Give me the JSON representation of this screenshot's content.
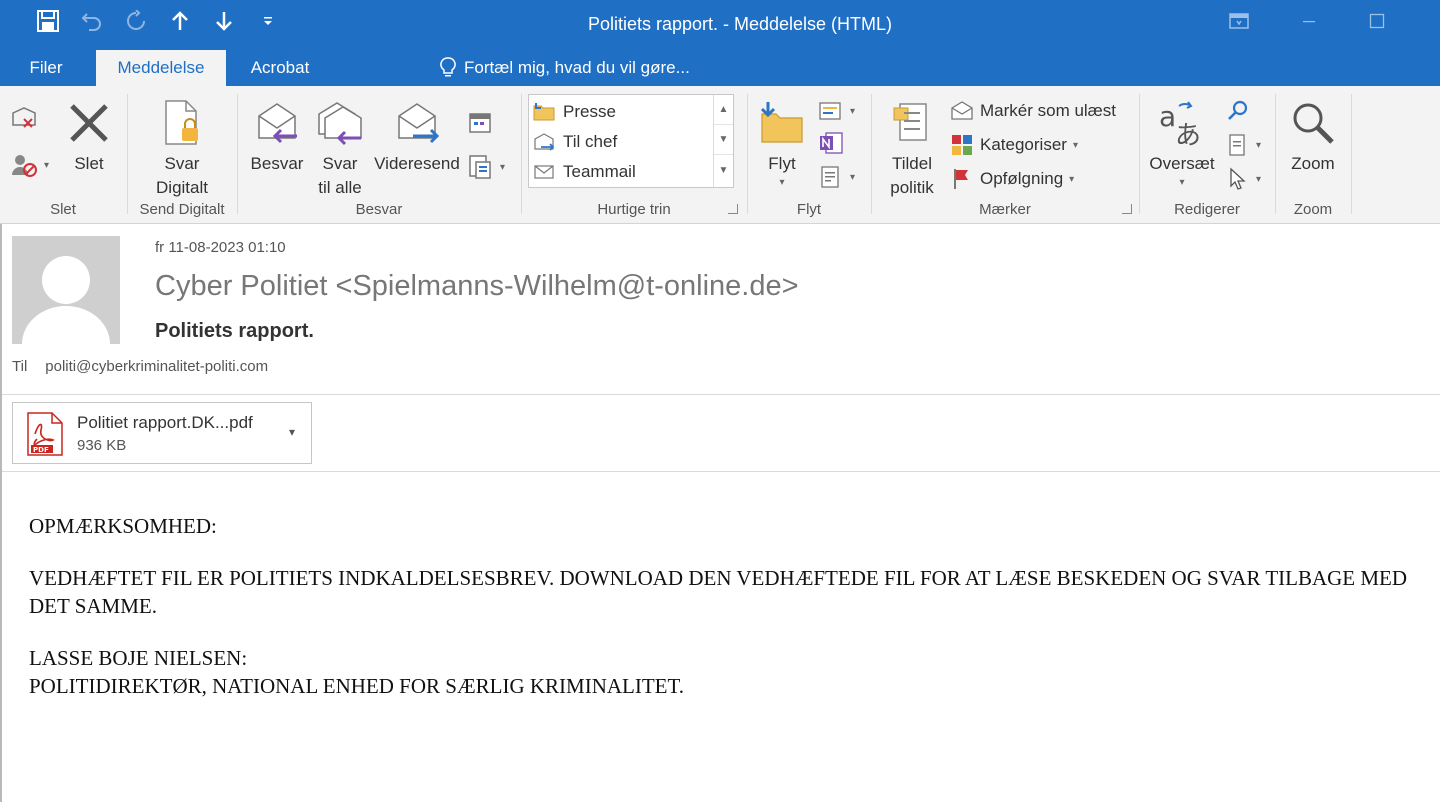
{
  "window": {
    "title": "Politiets rapport. - Meddelelse (HTML)"
  },
  "tabs": [
    {
      "label": "Filer"
    },
    {
      "label": "Meddelelse",
      "active": true
    },
    {
      "label": "Acrobat"
    }
  ],
  "tell_me": "Fortæl mig, hvad du vil gøre...",
  "ribbon": {
    "groups": {
      "slet": "Slet",
      "send_digitalt": "Send Digitalt",
      "besvar": "Besvar",
      "hurtige_trin": "Hurtige trin",
      "flyt": "Flyt",
      "maerker": "Mærker",
      "rediger": "Redigerer",
      "zoom": "Zoom"
    },
    "buttons": {
      "slet": "Slet",
      "svar_digitalt_1": "Svar",
      "svar_digitalt_2": "Digitalt",
      "besvar": "Besvar",
      "svar_til_alle_1": "Svar",
      "svar_til_alle_2": "til alle",
      "videresend": "Videresend",
      "flyt": "Flyt",
      "tildel_1": "Tildel",
      "tildel_2": "politik",
      "marker_ulaest": "Markér som ulæst",
      "kategoriser": "Kategoriser",
      "opfolgning": "Opfølgning",
      "oversaet": "Oversæt",
      "zoom": "Zoom"
    },
    "quick_steps": [
      "Presse",
      "Til chef",
      "Teammail"
    ]
  },
  "message": {
    "date": "fr 11-08-2023 01:10",
    "sender": "Cyber Politiet <Spielmanns-Wilhelm@t-online.de>",
    "subject": "Politiets rapport.",
    "to_label": "Til",
    "to": "politi@cyberkriminalitet-politi.com",
    "attachment": {
      "name": "Politiet rapport.DK...pdf",
      "size": "936 KB"
    },
    "body": {
      "p1": "OPMÆRKSOMHED:",
      "p2": "VEDHÆFTET FIL ER POLITIETS INDKALDELSESBREV. DOWNLOAD DEN VEDHÆFTEDE FIL FOR AT LÆSE BESKEDEN OG SVAR TILBAGE MED DET SAMME.",
      "p3_line1": "LASSE BOJE NIELSEN:",
      "p3_line2": "POLITIDIREKTØR, NATIONAL ENHED FOR SÆRLIG KRIMINALITET."
    }
  },
  "colors": {
    "accent": "#1f6fc5",
    "ribbon_bg": "#f3f3f3"
  }
}
